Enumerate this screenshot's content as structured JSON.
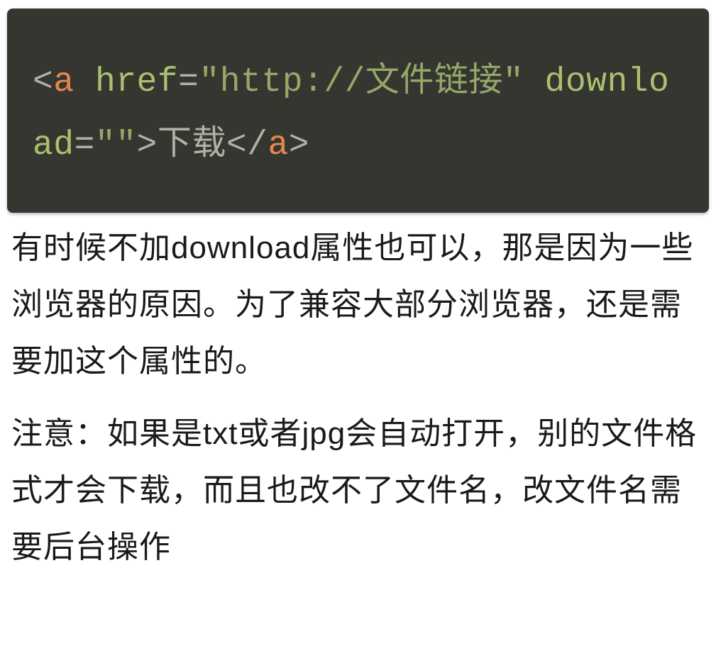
{
  "code": {
    "p1": "<",
    "tag1": "a",
    "p2": " ",
    "attr1": "href",
    "p3": "=",
    "str1": "\"http://文件链接\"",
    "p4": " ",
    "attr2": "download",
    "p5": "=",
    "str2": "\"\"",
    "p6": ">",
    "text1": "下载",
    "p7": "</",
    "tag2": "a",
    "p8": ">"
  },
  "paragraphs": {
    "p1": "有时候不加download属性也可以，那是因为一些浏览器的原因。为了兼容大部分浏览器，还是需要加这个属性的。",
    "p2": "注意：如果是txt或者jpg会自动打开，别的文件格式才会下载，而且也改不了文件名，改文件名需要后台操作"
  }
}
